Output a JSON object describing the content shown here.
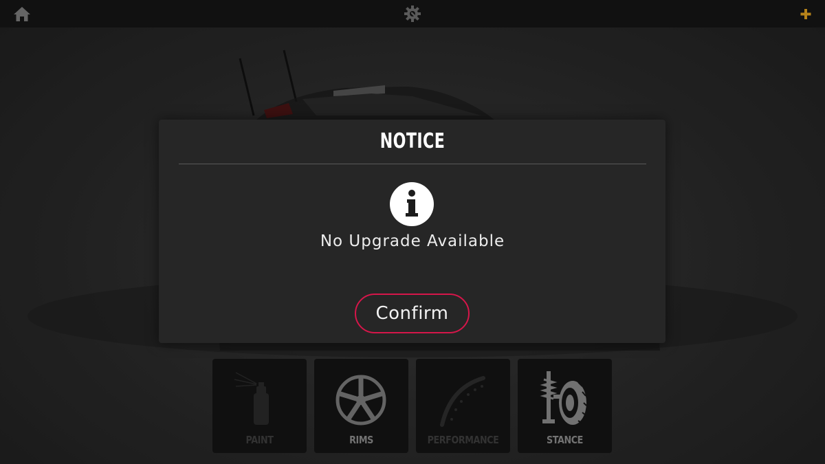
{
  "topbar": {
    "home_icon": "home-icon",
    "settings_icon": "gear-wrench-icon",
    "add_icon": "plus-icon",
    "add_icon_color": "#e0a020"
  },
  "menu": {
    "items": [
      {
        "label": "PAINT",
        "icon": "spray-can-icon",
        "enabled": false
      },
      {
        "label": "RIMS",
        "icon": "rim-icon",
        "enabled": true
      },
      {
        "label": "PERFORMANCE",
        "icon": "gauge-icon",
        "enabled": false
      },
      {
        "label": "STANCE",
        "icon": "suspension-icon",
        "enabled": true
      }
    ]
  },
  "modal": {
    "title": "NOTICE",
    "icon": "info-icon",
    "message": "No Upgrade Available",
    "confirm_label": "Confirm",
    "accent_color": "#d6164a"
  }
}
